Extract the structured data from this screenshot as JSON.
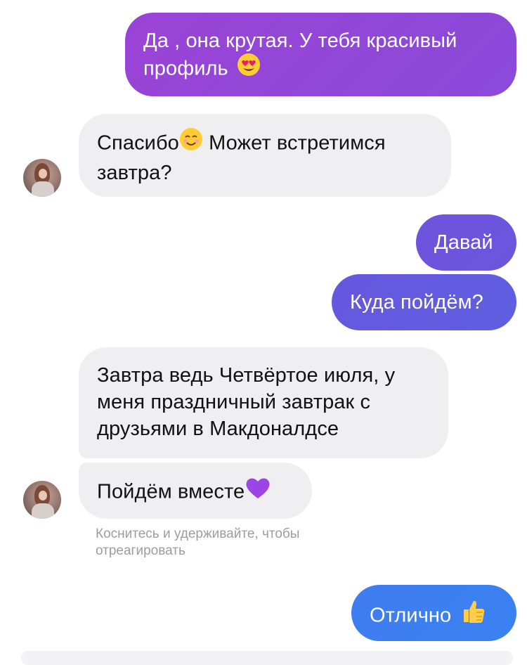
{
  "messages": [
    {
      "id": "m1",
      "direction": "out",
      "text": "Да , она крутая. У тебя красивый профиль",
      "emoji": "heart-eyes"
    },
    {
      "id": "m2",
      "direction": "in",
      "text_before": "Спасибо",
      "emoji": "smiling-face",
      "text_after": " Может встретимся завтра?"
    },
    {
      "id": "m3",
      "direction": "out",
      "text": "Давай"
    },
    {
      "id": "m4",
      "direction": "out",
      "text": "Куда пойдём?"
    },
    {
      "id": "m5",
      "direction": "in",
      "text": "Завтра ведь Четвёртое июля, у меня праздничный завтрак с друзьями в Макдоналдсе"
    },
    {
      "id": "m6",
      "direction": "in",
      "text": "Пойдём вместе",
      "emoji": "purple-heart"
    },
    {
      "id": "m7",
      "direction": "out",
      "text": "Отлично",
      "emoji": "thumbs-up"
    }
  ],
  "reaction_hint": "Коснитесь и удерживайте, чтобы отреагировать",
  "colors": {
    "outgoing_top": "#9447d8",
    "outgoing_mid": "#6a55dc",
    "outgoing_bottom": "#3f7cf0",
    "incoming_bg": "#efeff1",
    "hint_text": "#9c9ca3"
  }
}
